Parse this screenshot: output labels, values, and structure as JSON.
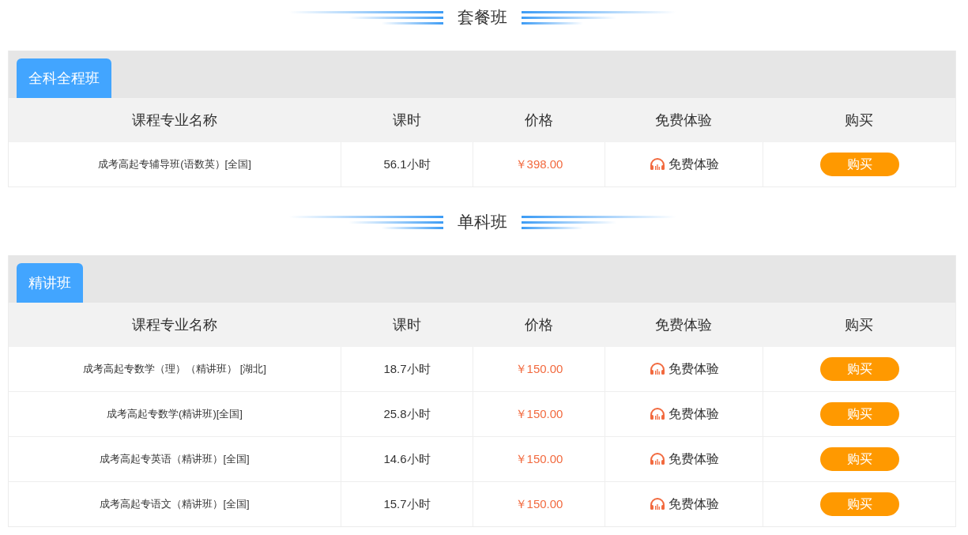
{
  "sections": [
    {
      "title": "套餐班",
      "tabs": [
        {
          "label": "全科全程班",
          "selected": true
        }
      ],
      "columns": [
        "课程专业名称",
        "课时",
        "价格",
        "免费体验",
        "购买"
      ],
      "rows": [
        {
          "name": "成考高起专辅导班(语数英）[全国]",
          "hours": "56.1小时",
          "price": "￥398.00",
          "trial": "免费体验",
          "buy": "购买"
        }
      ]
    },
    {
      "title": "单科班",
      "tabs": [
        {
          "label": "精讲班",
          "selected": true
        }
      ],
      "columns": [
        "课程专业名称",
        "课时",
        "价格",
        "免费体验",
        "购买"
      ],
      "rows": [
        {
          "name": "成考高起专数学（理）（精讲班） [湖北]",
          "hours": "18.7小时",
          "price": "￥150.00",
          "trial": "免费体验",
          "buy": "购买"
        },
        {
          "name": "成考高起专数学(精讲班)[全国]",
          "hours": "25.8小时",
          "price": "￥150.00",
          "trial": "免费体验",
          "buy": "购买"
        },
        {
          "name": "成考高起专英语（精讲班）[全国]",
          "hours": "14.6小时",
          "price": "￥150.00",
          "trial": "免费体验",
          "buy": "购买"
        },
        {
          "name": "成考高起专语文（精讲班）[全国]",
          "hours": "15.7小时",
          "price": "￥150.00",
          "trial": "免费体验",
          "buy": "购买"
        }
      ]
    }
  ]
}
